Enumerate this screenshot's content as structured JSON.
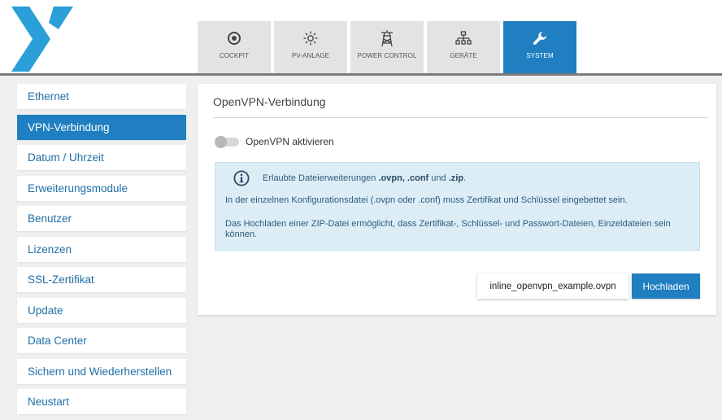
{
  "nav": {
    "tabs": [
      {
        "label": "COCKPIT",
        "icon": "target-icon"
      },
      {
        "label": "PV-ANLAGE",
        "icon": "sun-icon"
      },
      {
        "label": "POWER CONTROL",
        "icon": "power-tower-icon"
      },
      {
        "label": "GERÄTE",
        "icon": "network-icon"
      },
      {
        "label": "SYSTEM",
        "icon": "wrench-icon"
      }
    ],
    "active": "SYSTEM"
  },
  "sidebar": {
    "items": [
      {
        "label": "Ethernet"
      },
      {
        "label": "VPN-Verbindung"
      },
      {
        "label": "Datum / Uhrzeit"
      },
      {
        "label": "Erweiterungsmodule"
      },
      {
        "label": "Benutzer"
      },
      {
        "label": "Lizenzen"
      },
      {
        "label": "SSL-Zertifikat"
      },
      {
        "label": "Update"
      },
      {
        "label": "Data Center"
      },
      {
        "label": "Sichern und Wiederherstellen"
      },
      {
        "label": "Neustart"
      }
    ],
    "active": "VPN-Verbindung"
  },
  "panel": {
    "title": "OpenVPN-Verbindung",
    "toggle_label": "OpenVPN aktivieren",
    "toggle_on": false,
    "info": {
      "line1_prefix": "Erlaubte Dateierweiterungen ",
      "ext1": ".ovpn, .conf",
      "line1_mid": " und ",
      "ext2": ".zip",
      "line1_suffix": ".",
      "line2": "In der einzelnen Konfigurationsdatei (.ovpn oder .conf) muss Zertifikat und Schlüssel eingebettet sein.",
      "line3": "Das Hochladen einer ZIP-Datei ermöglicht, dass Zertifikat-, Schlüssel- und Passwort-Dateien, Einzeldateien sein können."
    },
    "file_name": "inline_openvpn_example.ovpn",
    "upload_label": "Hochladen"
  },
  "colors": {
    "accent": "#1f7fc0",
    "logo": "#2a9fd8",
    "info_bg": "#dcedf6"
  }
}
